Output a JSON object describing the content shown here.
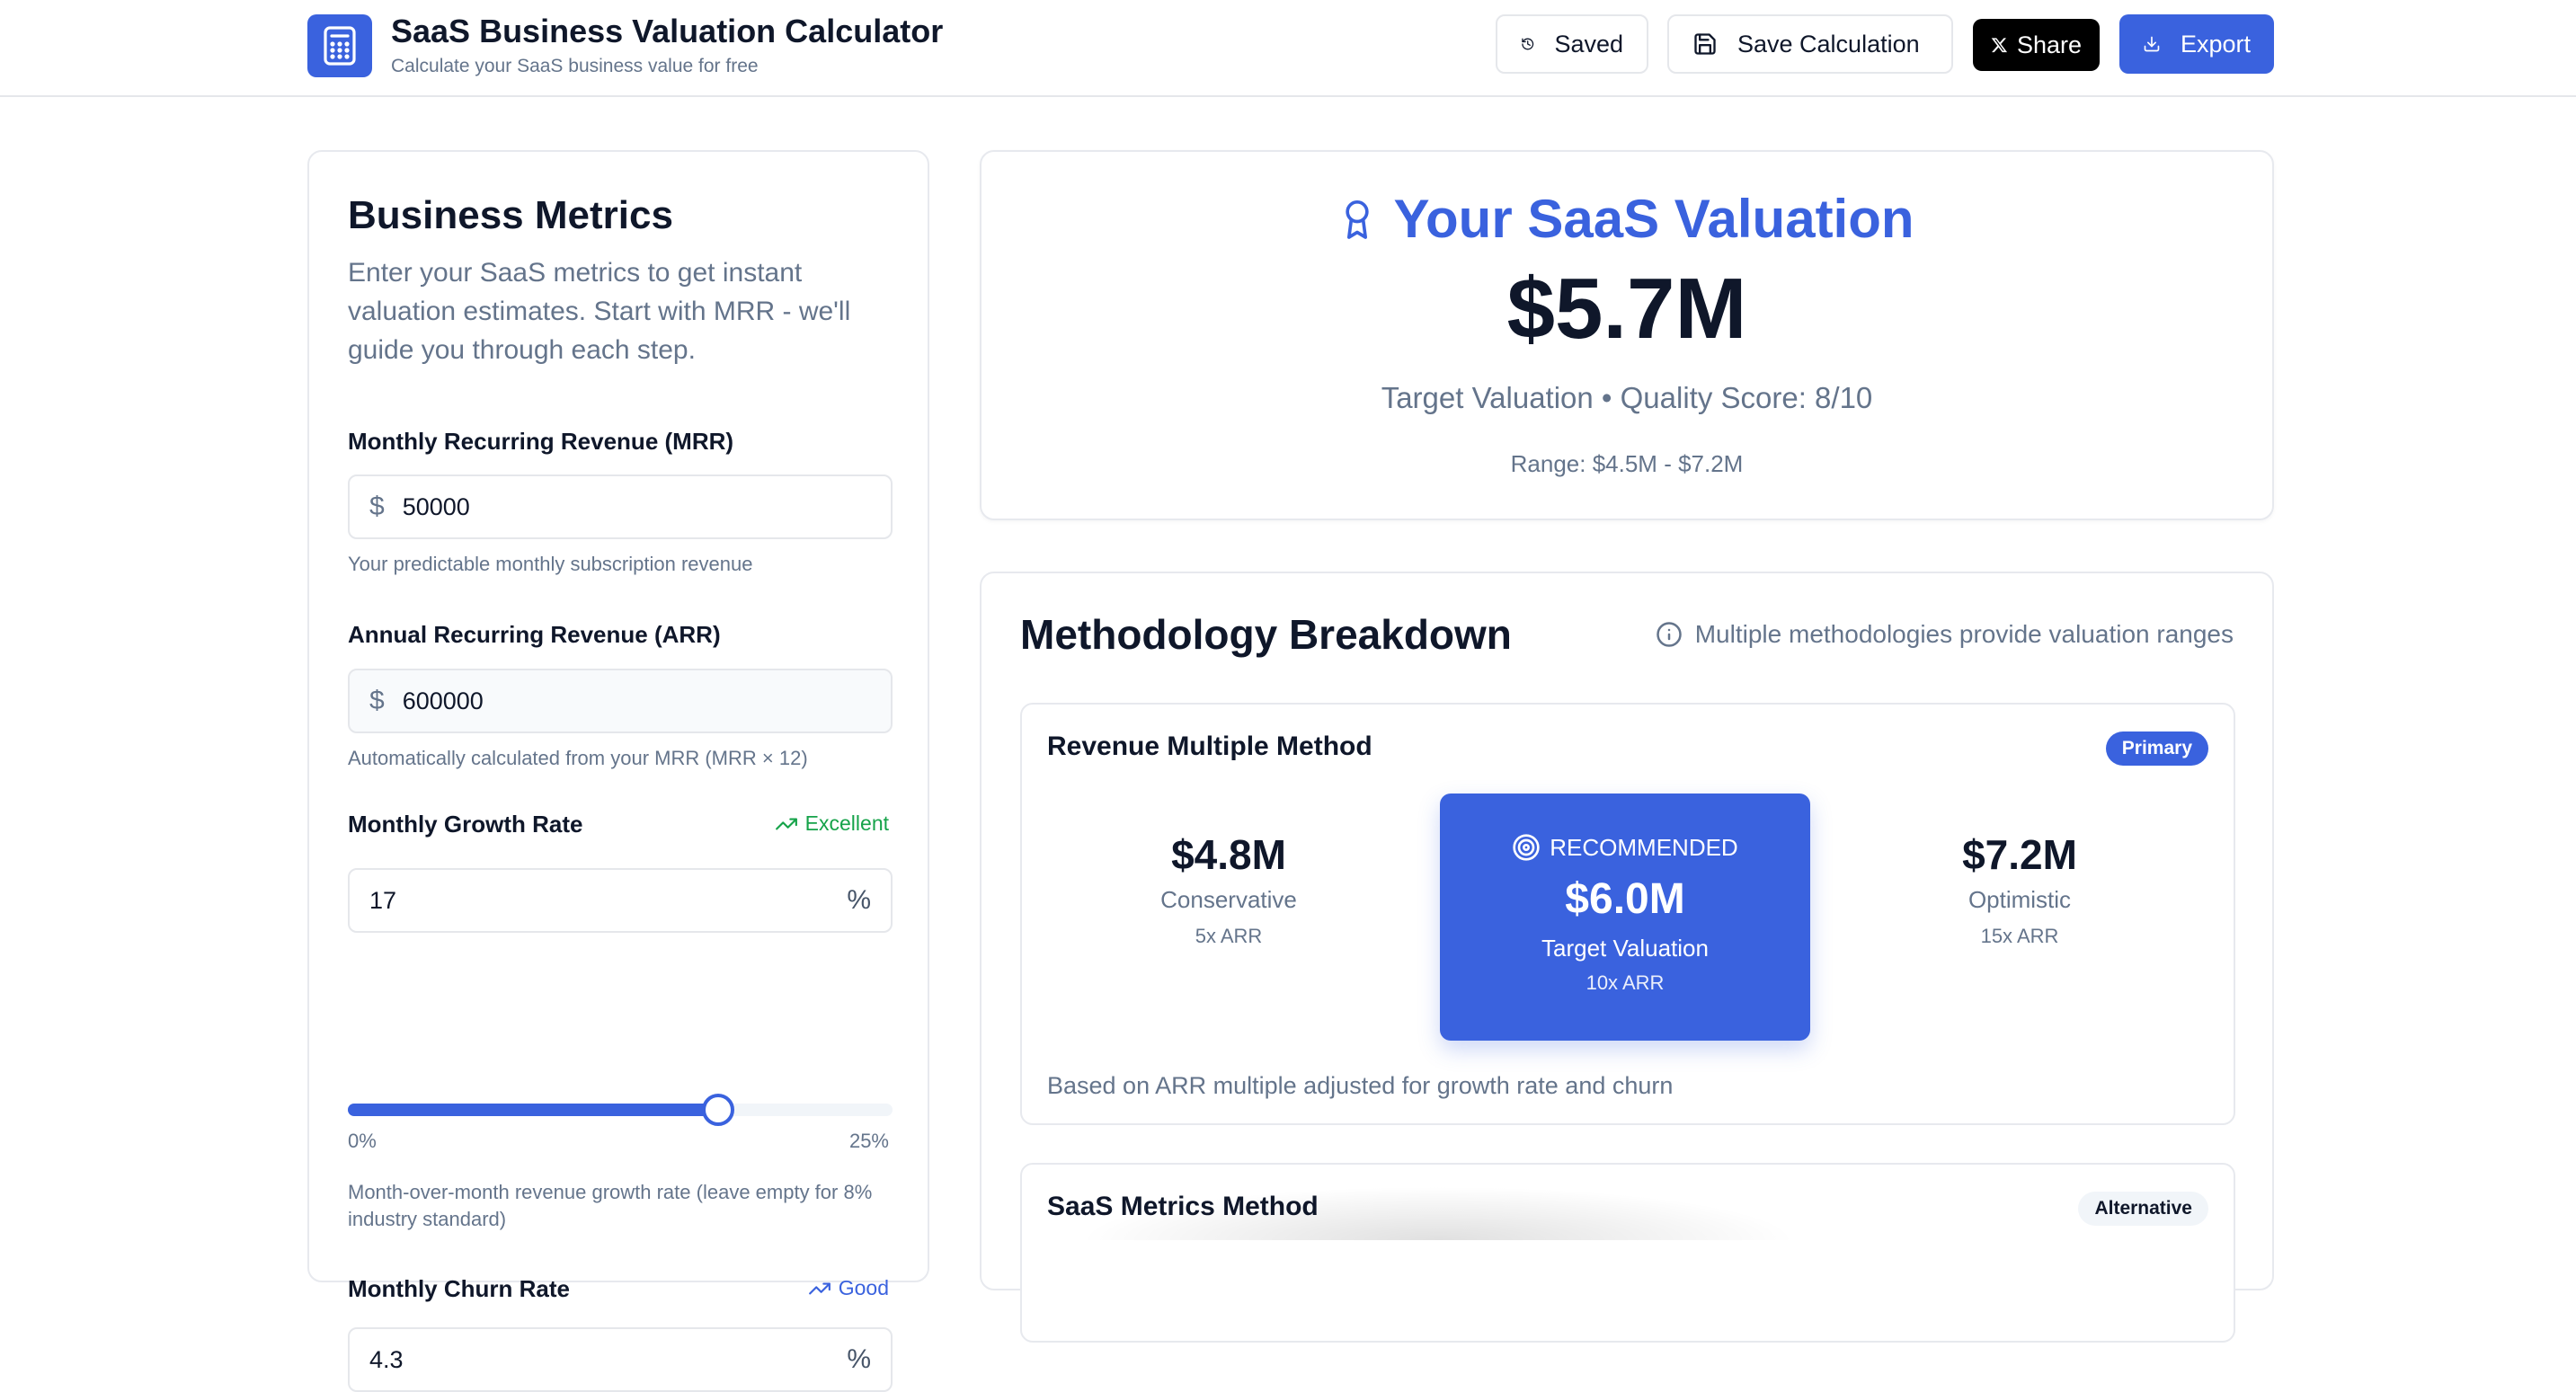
{
  "header": {
    "title": "SaaS Business Valuation Calculator",
    "subtitle": "Calculate your SaaS business value for free",
    "logo_icon": "calculator-icon",
    "buttons": {
      "saved": "Saved",
      "save_calculation": "Save Calculation",
      "share": "Share",
      "export": "Export"
    }
  },
  "metrics": {
    "title": "Business Metrics",
    "description": "Enter your SaaS metrics to get instant valuation estimates. Start with MRR - we'll guide you through each step.",
    "mrr": {
      "label": "Monthly Recurring Revenue (MRR)",
      "prefix": "$",
      "value": "50000",
      "hint": "Your predictable monthly subscription revenue"
    },
    "arr": {
      "label": "Annual Recurring Revenue (ARR)",
      "prefix": "$",
      "value": "600000",
      "hint": "Automatically calculated from your MRR (MRR × 12)"
    },
    "growth": {
      "label": "Monthly Growth Rate",
      "status": "Excellent",
      "status_color": "#16a34a",
      "value": "17",
      "suffix": "%",
      "slider_value": 17,
      "slider_min": 0,
      "slider_max": 25,
      "min_label": "0%",
      "max_label": "25%",
      "hint": "Month-over-month revenue growth rate (leave empty for 8% industry standard)"
    },
    "churn": {
      "label": "Monthly Churn Rate",
      "status": "Good",
      "status_color": "#3a62de",
      "value": "4.3",
      "suffix": "%"
    }
  },
  "valuation": {
    "title": "Your SaaS Valuation",
    "amount": "$5.7M",
    "subtitle": "Target Valuation • Quality Score: 8/10",
    "range": "Range: $4.5M - $7.2M"
  },
  "methodology": {
    "title": "Methodology Breakdown",
    "note": "Multiple methodologies provide valuation ranges",
    "revenue_multiple": {
      "title": "Revenue Multiple Method",
      "badge": "Primary",
      "conservative": {
        "amount": "$4.8M",
        "label": "Conservative",
        "multiple": "5x ARR"
      },
      "recommended": {
        "tag": "RECOMMENDED",
        "amount": "$6.0M",
        "label": "Target Valuation",
        "multiple": "10x ARR"
      },
      "optimistic": {
        "amount": "$7.2M",
        "label": "Optimistic",
        "multiple": "15x ARR"
      },
      "footnote": "Based on ARR multiple adjusted for growth rate and churn"
    },
    "saas_metrics": {
      "title": "SaaS Metrics Method",
      "badge": "Alternative"
    }
  },
  "colors": {
    "accent": "#3a62de",
    "text": "#0f172a",
    "muted": "#64748b",
    "border": "#e5e7eb"
  }
}
